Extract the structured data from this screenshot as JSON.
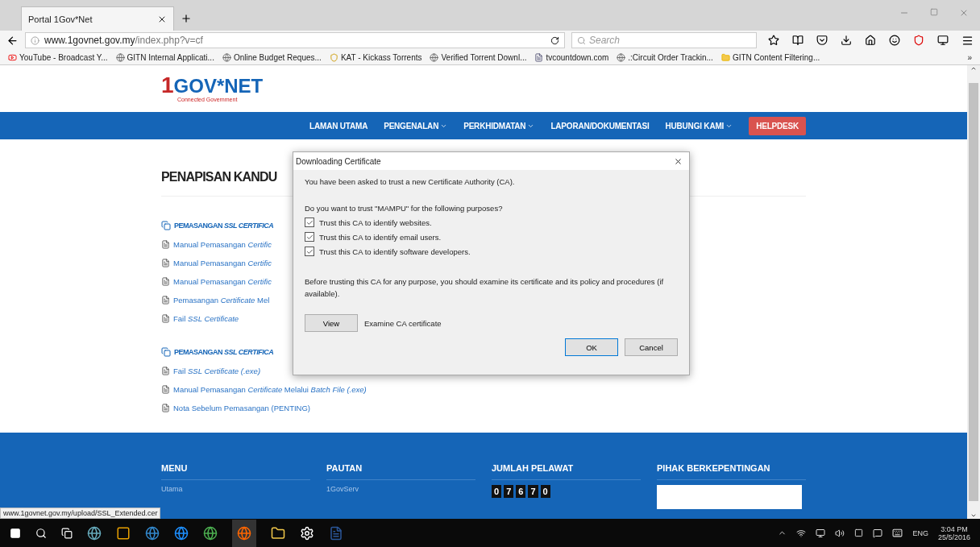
{
  "browser": {
    "tab_title": "Portal 1Gov*Net",
    "url_host": "www.1govnet.gov.my",
    "url_path": "/index.php?v=cf",
    "search_placeholder": "Search",
    "bookmarks": [
      {
        "kind": "video",
        "label": "YouTube - Broadcast Y..."
      },
      {
        "kind": "globe",
        "label": "GITN Internal Applicati..."
      },
      {
        "kind": "globe",
        "label": "Online Budget Reques..."
      },
      {
        "kind": "shield",
        "label": "KAT - Kickass Torrents"
      },
      {
        "kind": "globe",
        "label": "Verified Torrent Downl..."
      },
      {
        "kind": "page",
        "label": "tvcountdown.com"
      },
      {
        "kind": "globe",
        "label": ".:Circuit Order Trackin..."
      },
      {
        "kind": "folder",
        "label": "GITN Content Filtering..."
      }
    ],
    "overflow": "»"
  },
  "site": {
    "logo_prefix": "1",
    "logo_text": "GOV*NET",
    "logo_tagline": "Connected Government",
    "nav": [
      {
        "label": "LAMAN UTAMA",
        "dropdown": false,
        "kind": "link"
      },
      {
        "label": "PENGENALAN",
        "dropdown": true,
        "kind": "link"
      },
      {
        "label": "PERKHIDMATAN",
        "dropdown": true,
        "kind": "link"
      },
      {
        "label": "LAPORAN/DOKUMENTASI",
        "dropdown": false,
        "kind": "link"
      },
      {
        "label": "HUBUNGI KAMI",
        "dropdown": true,
        "kind": "link"
      },
      {
        "label": "HELPDESK",
        "dropdown": false,
        "kind": "button"
      }
    ],
    "page_title": "PENAPISAN KANDU",
    "sections": [
      {
        "heading": "PEMASANGAN *SSL CERTIFICA*",
        "links": [
          "Manual Pemasangan *Certific*",
          "Manual Pemasangan *Certific*",
          "Manual Pemasangan *Certific*",
          "Pemasangan *Certificate* Mel",
          "Fail *SSL Certificate*"
        ]
      },
      {
        "heading": "PEMASANGAN *SSL CERTIFICA*",
        "links": [
          "Fail *SSL Certificate (.exe)*",
          "Manual Pemasangan *Certificate* Melalui *Batch File (.exe)*",
          "Nota Sebelum Pemasangan (PENTING)"
        ]
      }
    ],
    "footer": {
      "columns": [
        {
          "title": "MENU",
          "item": "Utama"
        },
        {
          "title": "PAUTAN",
          "item": "1GovServ"
        },
        {
          "title": "JUMLAH PELAWAT",
          "digits": [
            "0",
            "7",
            "6",
            "7",
            "0"
          ]
        },
        {
          "title": "PIHAK BERKEPENTINGAN"
        }
      ]
    }
  },
  "dialog": {
    "title": "Downloading Certificate",
    "intro": "You have been asked to trust a new Certificate Authority (CA).",
    "question": "Do you want to trust \"MAMPU\" for the following purposes?",
    "options": [
      {
        "label": "Trust this CA to identify websites.",
        "checked": true
      },
      {
        "label": "Trust this CA to identify email users.",
        "checked": true
      },
      {
        "label": "Trust this CA to identify software developers.",
        "checked": true
      }
    ],
    "advice": "Before trusting this CA for any purpose, you should examine its certificate and its policy and procedures (if available).",
    "view_button": "View",
    "view_label": "Examine CA certificate",
    "ok_button": "OK",
    "cancel_button": "Cancel"
  },
  "status_url": "www.1govnet.gov.my/upload/SSL_Extended.cer",
  "taskbar": {
    "language": "ENG",
    "time": "3:04 PM",
    "date": "25/5/2016"
  }
}
